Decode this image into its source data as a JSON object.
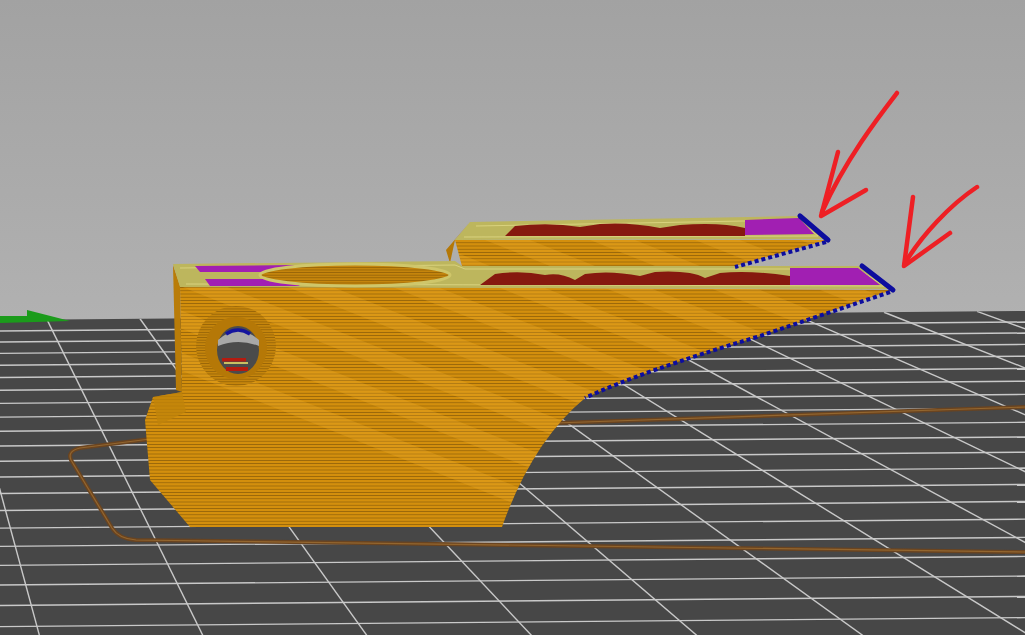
{
  "viewport": {
    "annotations": [
      {
        "kind": "arrow"
      },
      {
        "kind": "arrow"
      }
    ]
  }
}
